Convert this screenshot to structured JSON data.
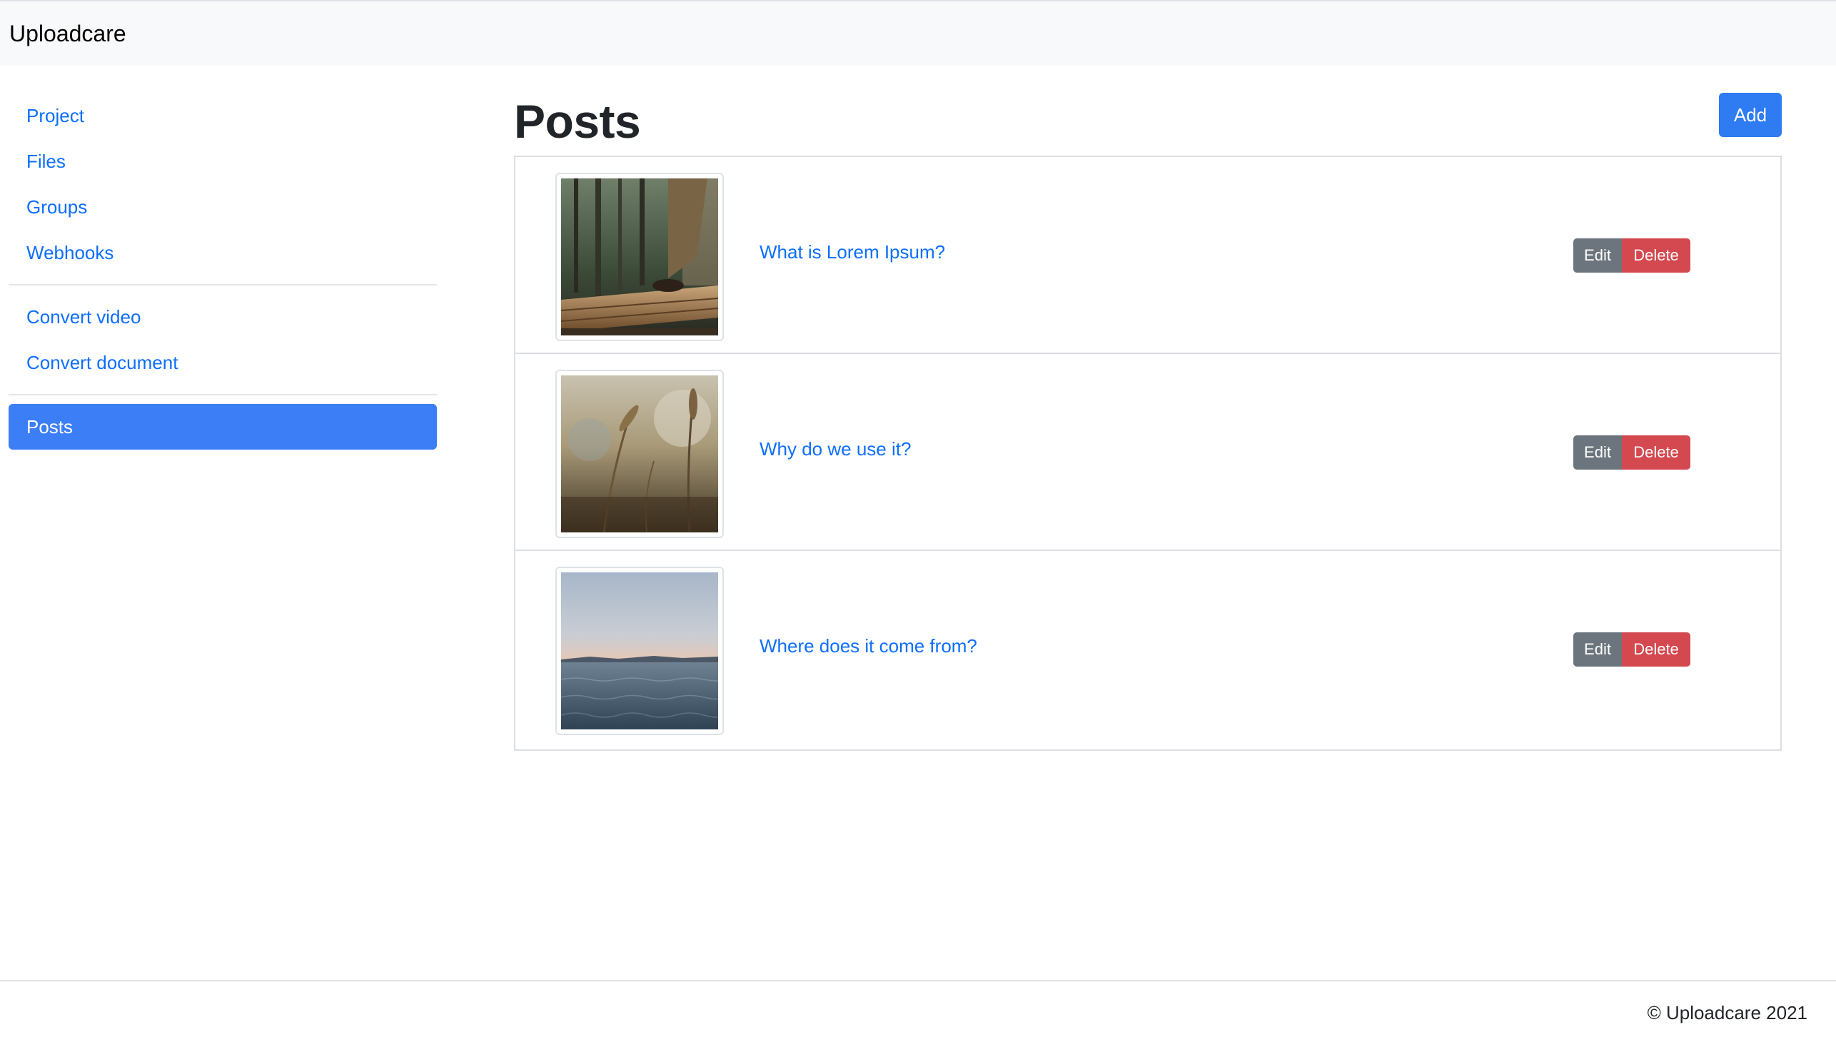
{
  "navbar": {
    "brand": "Uploadcare"
  },
  "sidebar": {
    "groups": [
      [
        "Project",
        "Files",
        "Groups",
        "Webhooks"
      ],
      [
        "Convert video",
        "Convert document"
      ],
      [
        "Posts"
      ]
    ],
    "active": "Posts"
  },
  "main": {
    "title": "Posts",
    "add_label": "Add",
    "posts": [
      {
        "title": "What is Lorem Ipsum?",
        "edit_label": "Edit",
        "delete_label": "Delete",
        "thumb": "forest-boardwalk-photo"
      },
      {
        "title": "Why do we use it?",
        "edit_label": "Edit",
        "delete_label": "Delete",
        "thumb": "wheat-grass-photo"
      },
      {
        "title": "Where does it come from?",
        "edit_label": "Edit",
        "delete_label": "Delete",
        "thumb": "sea-horizon-photo"
      }
    ]
  },
  "footer": {
    "text": "© Uploadcare 2021"
  },
  "colors": {
    "link": "#0d6efd",
    "primary": "#2f7bf2",
    "active_nav": "#3b7ef6",
    "edit_button": "#6c757d",
    "delete_button": "#d4484f",
    "navbar_bg": "#f8f9fa"
  }
}
